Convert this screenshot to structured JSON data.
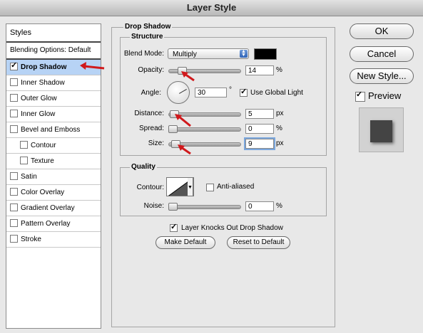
{
  "window": {
    "title": "Layer Style"
  },
  "styles": {
    "header": "Styles",
    "blending_options": "Blending Options: Default",
    "items": [
      {
        "label": "Drop Shadow",
        "checked": true,
        "selected": true
      },
      {
        "label": "Inner Shadow",
        "checked": false
      },
      {
        "label": "Outer Glow",
        "checked": false
      },
      {
        "label": "Inner Glow",
        "checked": false
      },
      {
        "label": "Bevel and Emboss",
        "checked": false
      },
      {
        "label": "Contour",
        "checked": false,
        "indent": true
      },
      {
        "label": "Texture",
        "checked": false,
        "indent": true
      },
      {
        "label": "Satin",
        "checked": false
      },
      {
        "label": "Color Overlay",
        "checked": false
      },
      {
        "label": "Gradient Overlay",
        "checked": false
      },
      {
        "label": "Pattern Overlay",
        "checked": false
      },
      {
        "label": "Stroke",
        "checked": false
      }
    ]
  },
  "drop_shadow": {
    "title": "Drop Shadow",
    "structure": {
      "title": "Structure",
      "blend_mode_label": "Blend Mode:",
      "blend_mode_value": "Multiply",
      "shadow_color": "#000000",
      "opacity_label": "Opacity:",
      "opacity_value": "14",
      "opacity_unit": "%",
      "opacity_fraction": 0.14,
      "angle_label": "Angle:",
      "angle_value": "30",
      "angle_unit": "°",
      "use_global_light_label": "Use Global Light",
      "use_global_light": true,
      "distance_label": "Distance:",
      "distance_value": "5",
      "distance_unit": "px",
      "distance_fraction": 0.02,
      "spread_label": "Spread:",
      "spread_value": "0",
      "spread_unit": "%",
      "spread_fraction": 0.0,
      "size_label": "Size:",
      "size_value": "9",
      "size_unit": "px",
      "size_fraction": 0.04
    },
    "quality": {
      "title": "Quality",
      "contour_label": "Contour:",
      "anti_aliased_label": "Anti-aliased",
      "anti_aliased": false,
      "noise_label": "Noise:",
      "noise_value": "0",
      "noise_unit": "%",
      "noise_fraction": 0.0
    },
    "knocks_out_label": "Layer Knocks Out Drop Shadow",
    "knocks_out": true,
    "make_default_label": "Make Default",
    "reset_default_label": "Reset to Default"
  },
  "buttons": {
    "ok": "OK",
    "cancel": "Cancel",
    "new_style": "New Style...",
    "preview_label": "Preview",
    "preview_checked": true
  },
  "colors": {
    "selected_row": "#b7d3f5",
    "annotation_arrow": "#d0191c",
    "select_arrow": "#2e64b8"
  }
}
